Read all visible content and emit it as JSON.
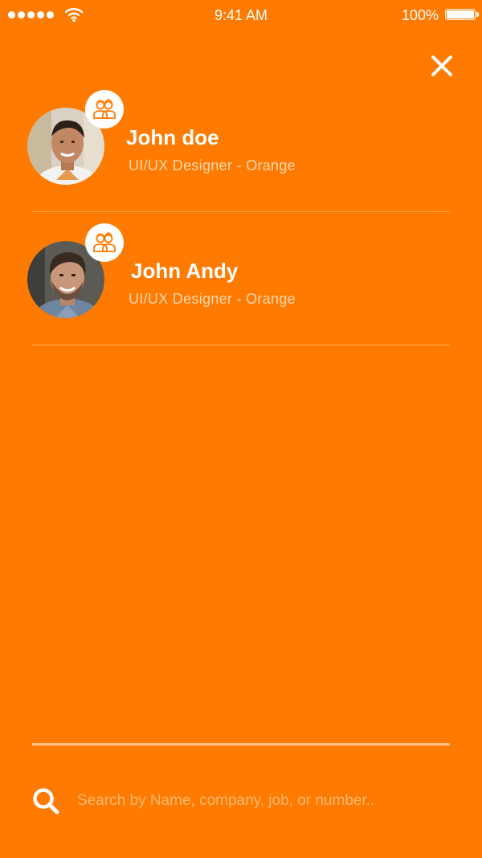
{
  "status_bar": {
    "time": "9:41 AM",
    "battery": "100%",
    "signal_icon": "signal-dots-icon",
    "wifi_icon": "wifi-icon",
    "battery_icon": "battery-icon"
  },
  "header": {
    "close_icon": "close-icon"
  },
  "contacts": [
    {
      "name": "John doe",
      "role": "UI/UX Designer - Orange",
      "badge_icon": "contacts-group-icon"
    },
    {
      "name": "John Andy",
      "role": "UI/UX Designer - Orange",
      "badge_icon": "contacts-group-icon"
    }
  ],
  "search": {
    "placeholder": "Search by Name, company, job, or number..",
    "value": "",
    "icon": "search-icon"
  },
  "colors": {
    "background": "#FF7A00",
    "text": "#FFFFFF",
    "subtext": "#FFD7B0",
    "placeholder": "#FFB870"
  }
}
